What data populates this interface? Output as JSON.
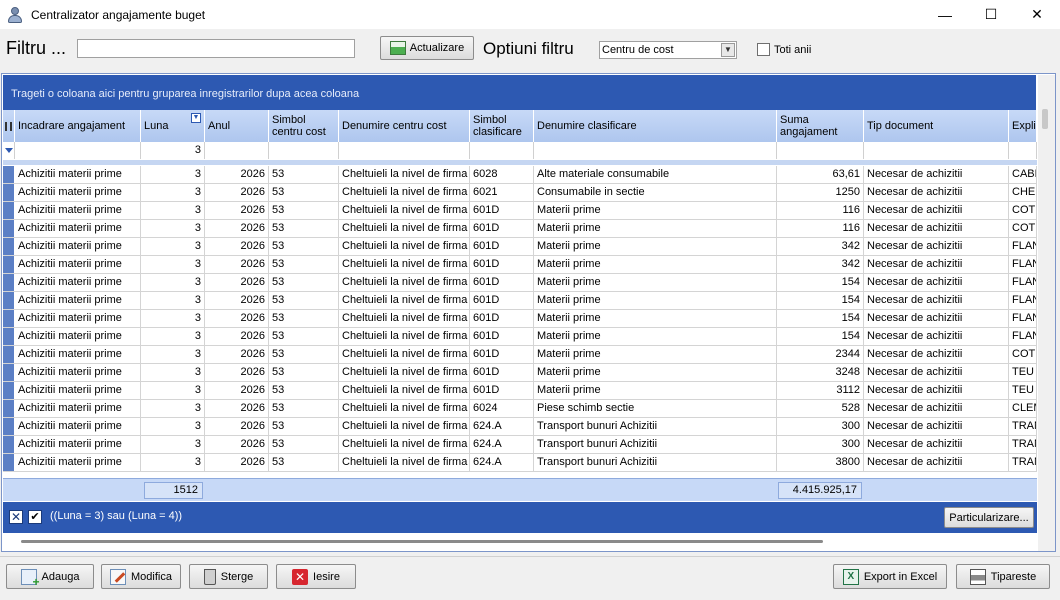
{
  "window": {
    "title": "Centralizator angajamente buget",
    "minimize": "—",
    "maximize": "☐",
    "close": "✕"
  },
  "filter": {
    "label": "Filtru ...",
    "value": "",
    "refresh_label": "Actualizare",
    "options_label": "Optiuni filtru",
    "select_value": "Centru de cost",
    "all_years_label": "Toti anii"
  },
  "grid": {
    "group_hint": "Trageti o coloana aici pentru gruparea inregistrarilor dupa acea coloana",
    "columns": [
      "Incadrare angajament",
      "Luna",
      "Anul",
      "Simbol centru cost",
      "Denumire centru cost",
      "Simbol clasificare",
      "Denumire clasificare",
      "Suma angajament",
      "Tip document",
      "Explic"
    ],
    "filter_values": [
      "",
      "3",
      "",
      "",
      "",
      "",
      "",
      "",
      "",
      ""
    ],
    "rows": [
      [
        "Achizitii materii prime",
        "3",
        "2026",
        "53",
        "Cheltuieli la nivel de firma",
        "6028",
        "Alte materiale consumabile",
        "63,61",
        "Necesar de achizitii",
        "CABLU"
      ],
      [
        "Achizitii materii prime",
        "3",
        "2026",
        "53",
        "Cheltuieli la nivel de firma",
        "6021",
        "Consumabile in sectie",
        "1250",
        "Necesar de achizitii",
        "CHER"
      ],
      [
        "Achizitii materii prime",
        "3",
        "2026",
        "53",
        "Cheltuieli la nivel de firma",
        "601D",
        "Materii prime",
        "116",
        "Necesar de achizitii",
        "COT F"
      ],
      [
        "Achizitii materii prime",
        "3",
        "2026",
        "53",
        "Cheltuieli la nivel de firma",
        "601D",
        "Materii prime",
        "116",
        "Necesar de achizitii",
        "COT F"
      ],
      [
        "Achizitii materii prime",
        "3",
        "2026",
        "53",
        "Cheltuieli la nivel de firma",
        "601D",
        "Materii prime",
        "342",
        "Necesar de achizitii",
        "FLANS"
      ],
      [
        "Achizitii materii prime",
        "3",
        "2026",
        "53",
        "Cheltuieli la nivel de firma",
        "601D",
        "Materii prime",
        "342",
        "Necesar de achizitii",
        "FLANS"
      ],
      [
        "Achizitii materii prime",
        "3",
        "2026",
        "53",
        "Cheltuieli la nivel de firma",
        "601D",
        "Materii prime",
        "154",
        "Necesar de achizitii",
        "FLANS"
      ],
      [
        "Achizitii materii prime",
        "3",
        "2026",
        "53",
        "Cheltuieli la nivel de firma",
        "601D",
        "Materii prime",
        "154",
        "Necesar de achizitii",
        "FLANS"
      ],
      [
        "Achizitii materii prime",
        "3",
        "2026",
        "53",
        "Cheltuieli la nivel de firma",
        "601D",
        "Materii prime",
        "154",
        "Necesar de achizitii",
        "FLANS"
      ],
      [
        "Achizitii materii prime",
        "3",
        "2026",
        "53",
        "Cheltuieli la nivel de firma",
        "601D",
        "Materii prime",
        "154",
        "Necesar de achizitii",
        "FLANS"
      ],
      [
        "Achizitii materii prime",
        "3",
        "2026",
        "53",
        "Cheltuieli la nivel de firma",
        "601D",
        "Materii prime",
        "2344",
        "Necesar de achizitii",
        "COT F"
      ],
      [
        "Achizitii materii prime",
        "3",
        "2026",
        "53",
        "Cheltuieli la nivel de firma",
        "601D",
        "Materii prime",
        "3248",
        "Necesar de achizitii",
        "TEU T"
      ],
      [
        "Achizitii materii prime",
        "3",
        "2026",
        "53",
        "Cheltuieli la nivel de firma",
        "601D",
        "Materii prime",
        "3112",
        "Necesar de achizitii",
        "TEU T"
      ],
      [
        "Achizitii materii prime",
        "3",
        "2026",
        "53",
        "Cheltuieli la nivel de firma",
        "6024",
        "Piese schimb sectie",
        "528",
        "Necesar de achizitii",
        "CLEM"
      ],
      [
        "Achizitii materii prime",
        "3",
        "2026",
        "53",
        "Cheltuieli la nivel de firma",
        "624.A",
        "Transport bunuri Achizitii",
        "300",
        "Necesar de achizitii",
        "TRAN"
      ],
      [
        "Achizitii materii prime",
        "3",
        "2026",
        "53",
        "Cheltuieli la nivel de firma",
        "624.A",
        "Transport bunuri Achizitii",
        "300",
        "Necesar de achizitii",
        "TRAN"
      ],
      [
        "Achizitii materii prime",
        "3",
        "2026",
        "53",
        "Cheltuieli la nivel de firma",
        "624.A",
        "Transport bunuri Achizitii",
        "3800",
        "Necesar de achizitii",
        "TRAN"
      ]
    ],
    "summary": {
      "luna_total": "1512",
      "suma_total": "4.415.925,17"
    },
    "active_filter": "((Luna = 3) sau (Luna = 4))",
    "customize_label": "Particularizare..."
  },
  "toolbar": {
    "add": "Adauga",
    "edit": "Modifica",
    "delete": "Sterge",
    "exit": "Iesire",
    "export": "Export in Excel",
    "print": "Tipareste"
  }
}
